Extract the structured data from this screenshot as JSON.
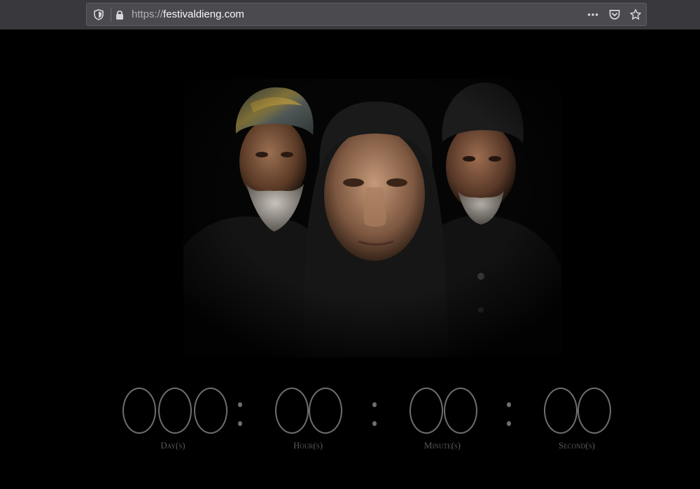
{
  "browser": {
    "url_scheme": "https://",
    "url_host": "festivaldieng.com",
    "icons": [
      "shield-icon",
      "lock-icon",
      "more-icon",
      "pocket-icon",
      "star-icon"
    ]
  },
  "countdown": {
    "days": [
      "0",
      "0",
      "0"
    ],
    "hours": [
      "0",
      "0"
    ],
    "minutes": [
      "0",
      "0"
    ],
    "seconds": [
      "0",
      "0"
    ],
    "labels": {
      "days": "Day(s)",
      "hours": "Hour(s)",
      "minutes": "Minute(s)",
      "seconds": "Second(s)"
    },
    "digit_color": "#6e6e6e",
    "label_color": "#5a5a5a"
  },
  "colors": {
    "background": "#000000",
    "toolbar": "#38383d",
    "urlbar": "#4a4a4f"
  }
}
